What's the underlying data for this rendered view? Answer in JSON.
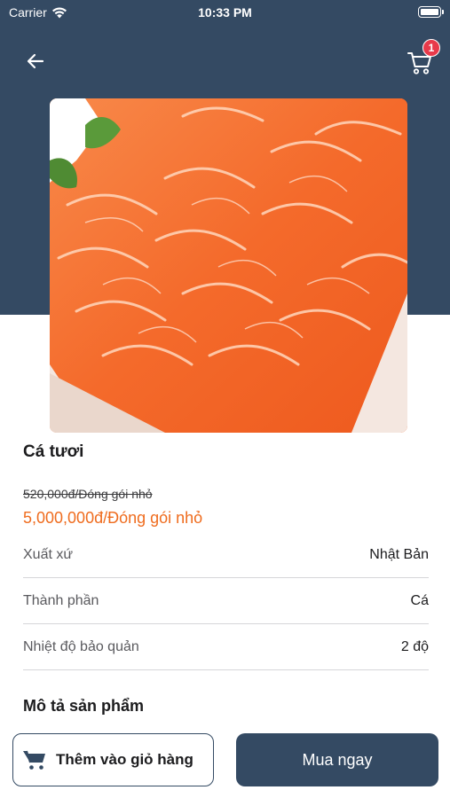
{
  "status_bar": {
    "carrier": "Carrier",
    "time": "10:33 PM"
  },
  "header": {
    "cart_count": "1"
  },
  "product": {
    "name": "Cá tươi",
    "old_price": "520,000đ/Đóng gói nhỏ",
    "new_price": "5,000,000đ/Đóng gói nhỏ",
    "specs": [
      {
        "label": "Xuất xứ",
        "value": "Nhật Bản"
      },
      {
        "label": "Thành phần",
        "value": "Cá"
      },
      {
        "label": "Nhiệt độ bảo quản",
        "value": "2 độ"
      }
    ],
    "description_title": "Mô tả sản phẩm"
  },
  "actions": {
    "add_to_cart_label": "Thêm vào giỏ hàng",
    "buy_now_label": "Mua ngay"
  },
  "colors": {
    "header": "#344a63",
    "price": "#ef6c1e",
    "badge": "#e8394a"
  },
  "icons": {
    "back": "arrow-left-icon",
    "cart": "cart-icon",
    "wifi": "wifi-icon",
    "battery": "battery-icon"
  }
}
